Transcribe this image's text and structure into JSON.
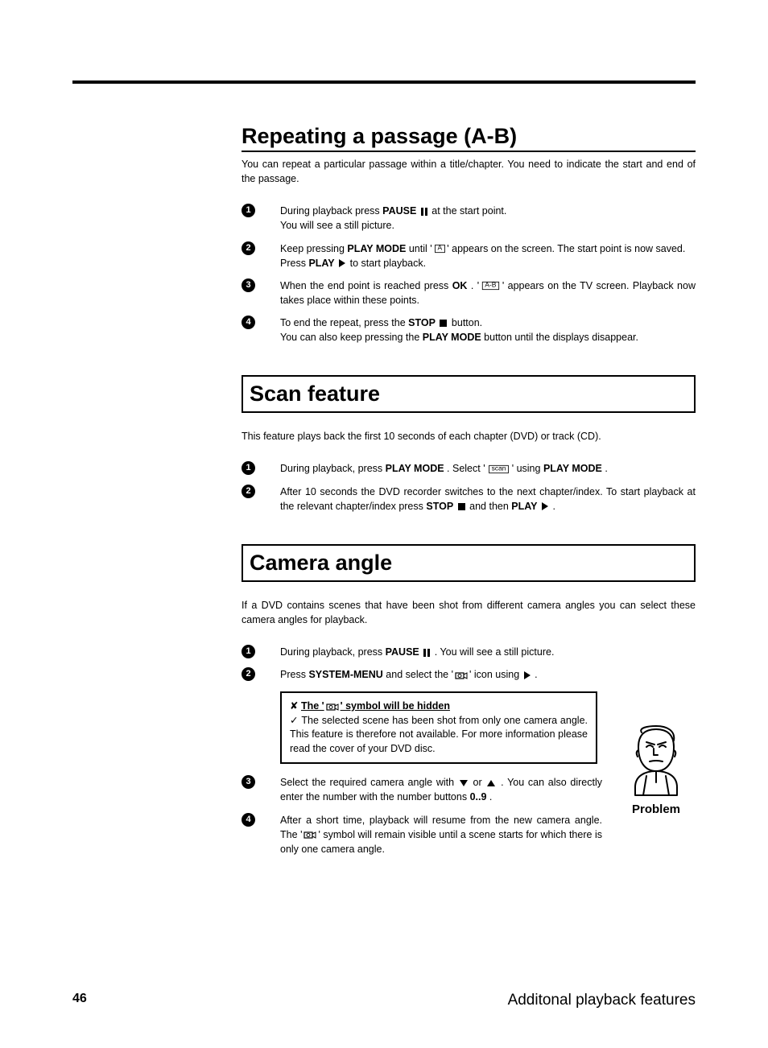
{
  "page_number": "46",
  "chapter_footer": "Additonal playback features",
  "problem_label": "Problem",
  "sec1_title": "Repeating a passage (A-B)",
  "sec1_intro": "You can repeat a particular passage within a title/chapter. You need to indicate the start and end of the passage.",
  "s1_1a": "During playback press ",
  "s1_1_pause": "PAUSE",
  "s1_1b": " at the start point.",
  "s1_1c": "You will see a still picture.",
  "s1_2a": "Keep pressing ",
  "s1_2_pm": "PLAY MODE",
  "s1_2b": " until '",
  "s1_2_sym": "A",
  "s1_2c": "' appears on the screen. The start point is now saved.",
  "s1_2d": "Press ",
  "s1_2_play": "PLAY",
  "s1_2e": " to start playback.",
  "s1_3a": "When the end point is reached press ",
  "s1_3_ok": "OK",
  "s1_3b": " . '",
  "s1_3_sym": "A-B",
  "s1_3c": "' appears on the TV screen. Playback now takes place within these points.",
  "s1_4a": "To end the repeat, press the ",
  "s1_4_stop": "STOP",
  "s1_4b": " button.",
  "s1_4c": "You can also keep pressing the ",
  "s1_4_pm": "PLAY MODE",
  "s1_4d": " button until the displays disappear.",
  "sec2_title": "Scan feature",
  "sec2_intro": "This feature plays back the first 10 seconds of each chapter (DVD) or track (CD).",
  "s2_1a": "During playback, press ",
  "s2_1_pm": "PLAY MODE",
  "s2_1b": " . Select '",
  "s2_1_sym": "scan",
  "s2_1c": "' using ",
  "s2_1_pm2": "PLAY MODE",
  "s2_1d": " .",
  "s2_2a": "After 10 seconds the DVD recorder switches to the next chapter/index. To start playback at the relevant chapter/index press ",
  "s2_2_stop": "STOP",
  "s2_2b": " and then ",
  "s2_2_play": "PLAY",
  "s2_2c": " .",
  "sec3_title": "Camera angle",
  "sec3_intro": "If a DVD contains scenes that have been shot from different camera angles you can select these camera angles for playback.",
  "s3_1a": "During playback, press ",
  "s3_1_pause": "PAUSE",
  "s3_1b": "  . You will see a still picture.",
  "s3_2a": "Press ",
  "s3_2_sm": "SYSTEM-MENU",
  "s3_2b": " and select the '",
  "s3_2c": "' icon using ",
  "s3_2d": " .",
  "box_x": "✘",
  "box_title_a": "The '",
  "box_title_b": "' symbol will be hidden",
  "box_check": "✓",
  "box_body": " The selected scene has been shot from only one camera angle. This feature is therefore not available. For more information please read the cover of your DVD disc.",
  "s3_3a": "Select the required camera angle with ",
  "s3_3b": " or ",
  "s3_3c": " . You can also directly enter the number with the number buttons ",
  "s3_3_nums": "0..9",
  "s3_3d": " .",
  "s3_4a": "After a short time, playback will resume from the new camera angle. The '",
  "s3_4b": "' symbol will remain visible until a scene starts for which there is only one camera angle."
}
